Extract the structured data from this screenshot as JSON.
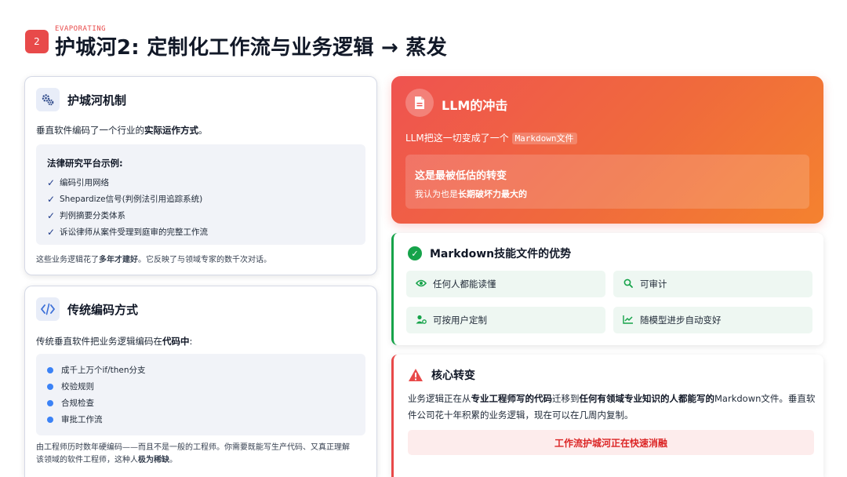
{
  "header": {
    "number": "2",
    "kicker": "EVAPORATING",
    "title": "护城河2: 定制化工作流与业务逻辑 → 蒸发"
  },
  "moat_card": {
    "icon": "gears-icon",
    "title": "护城河机制",
    "intro_prefix": "垂直软件编码了一个行业的",
    "intro_bold": "实际运作方式",
    "intro_suffix": "。",
    "box_title": "法律研究平台示例:",
    "items": [
      "编码引用网络",
      "Shepardize信号(判例法引用追踪系统)",
      "判例摘要分类体系",
      "诉讼律师从案件受理到庭审的完整工作流"
    ],
    "note_prefix": "这些业务逻辑花了",
    "note_bold": "多年才建好",
    "note_suffix": "。它反映了与领域专家的数千次对话。"
  },
  "traditional_card": {
    "icon": "code-icon",
    "title": "传统编码方式",
    "intro_prefix": "传统垂直软件把业务逻辑编码在",
    "intro_bold": "代码中",
    "intro_suffix": ":",
    "items": [
      "成千上万个if/then分支",
      "校验规则",
      "合规检查",
      "审批工作流"
    ],
    "note_line1": "由工程师历时数年硬编码——而且不是一般的工程师。你需要既能写生产代码、又真正理解",
    "note_line2_prefix": "该领域的软件工程师，这种人",
    "note_line2_bold": "极为稀缺",
    "note_line2_suffix": "。"
  },
  "llm_card": {
    "icon": "document-icon",
    "title": "LLM的冲击",
    "sub_prefix": "LLM把这一切变成了一个",
    "sub_code": "Markdown文件",
    "inner_title": "这是最被低估的转变",
    "inner_sub_prefix": "我认为也是",
    "inner_sub_bold": "长期破坏力最大的",
    "colors": {
      "from": "#ef5350",
      "to": "#f4822f"
    }
  },
  "advantages_card": {
    "title": "Markdown技能文件的优势",
    "accent": "#16a34a",
    "tiles": [
      {
        "icon": "eye-icon",
        "label": "任何人都能读懂"
      },
      {
        "icon": "search-icon",
        "label": "可审计"
      },
      {
        "icon": "user-gear-icon",
        "label": "可按用户定制"
      },
      {
        "icon": "chart-line-icon",
        "label": "随模型进步自动变好"
      }
    ]
  },
  "shift_card": {
    "title": "核心转变",
    "accent": "#e84a4a",
    "t1": "业务逻辑正在从",
    "b1": "专业工程师写的代码",
    "t2": "迁移到",
    "b2": "任何有领域专业知识的人都能写的",
    "t3": "Markdown文件。垂直软件公司花十年积累的业务逻辑，现在可以在几周内复制。",
    "banner": "工作流护城河正在快速消融"
  }
}
